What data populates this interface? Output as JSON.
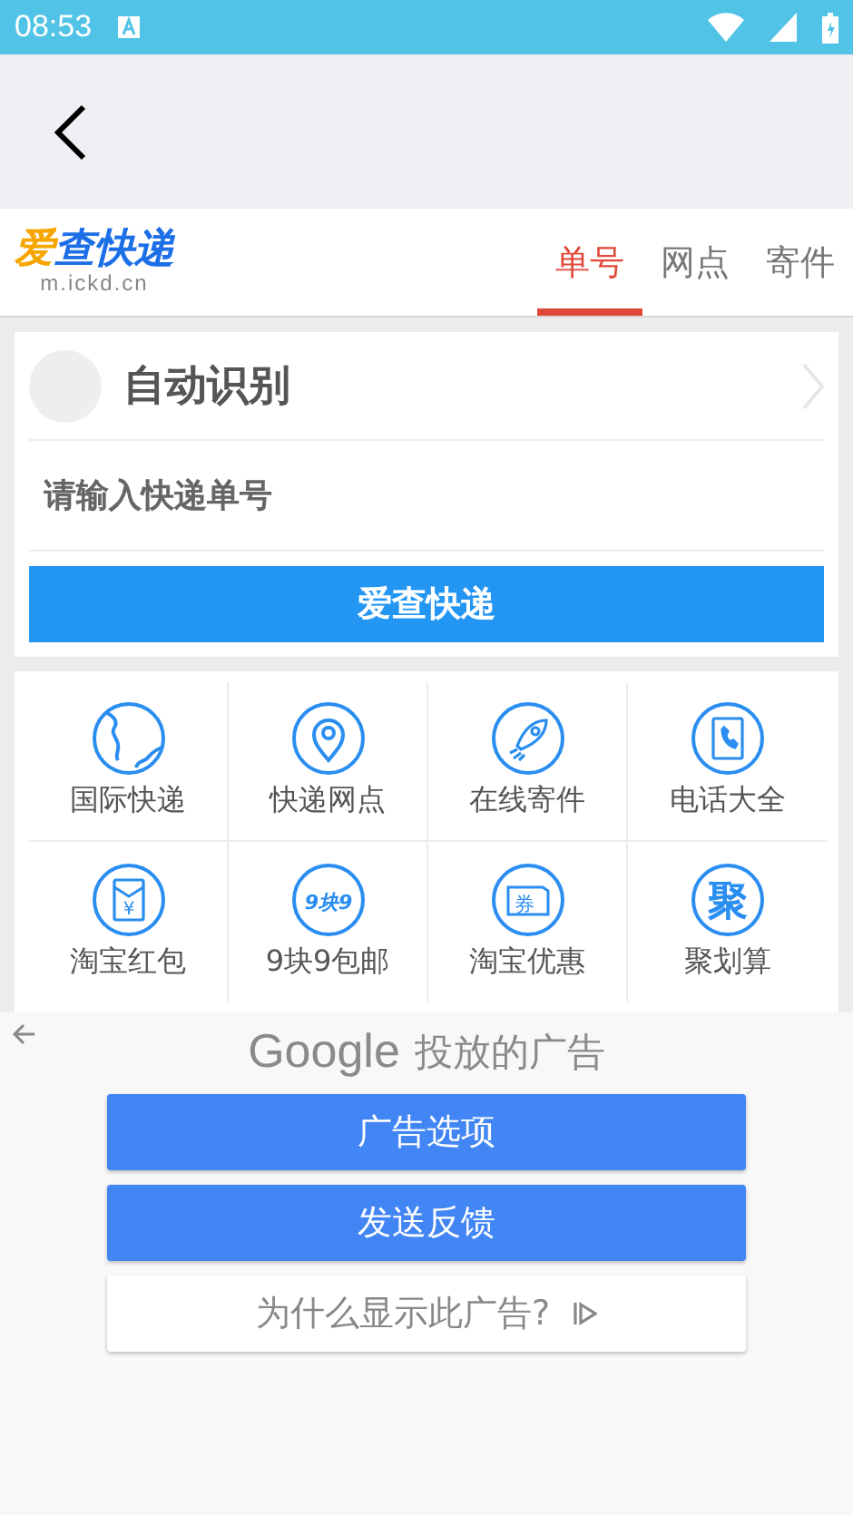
{
  "status_bar": {
    "time": "08:53"
  },
  "logo": {
    "parts": [
      {
        "text": "爱",
        "color": "#f7a600"
      },
      {
        "text": "查快递",
        "color": "#1c6fe6"
      }
    ],
    "domain": "m.ickd.cn"
  },
  "tabs": [
    {
      "label": "单号",
      "selected": true
    },
    {
      "label": "网点",
      "selected": false
    },
    {
      "label": "寄件",
      "selected": false
    }
  ],
  "query": {
    "carrier": "自动识别",
    "placeholder": "请输入快递单号",
    "button": "爱查快递"
  },
  "services": [
    {
      "kind": "globe",
      "label": "国际快递"
    },
    {
      "kind": "pin",
      "label": "快递网点"
    },
    {
      "kind": "rocket",
      "label": "在线寄件"
    },
    {
      "kind": "phonebook",
      "label": "电话大全"
    },
    {
      "kind": "envelope",
      "badge": "¥",
      "label": "淘宝红包"
    },
    {
      "kind": "text",
      "badge": "9块9",
      "label": "9块9包邮"
    },
    {
      "kind": "coupon",
      "badge": "券",
      "label": "淘宝优惠"
    },
    {
      "kind": "bigtext",
      "badge": "聚",
      "label": "聚划算"
    }
  ],
  "ad": {
    "brand": "Google",
    "title": "投放的广告",
    "buttons": [
      {
        "kind": "primary",
        "label": "广告选项"
      },
      {
        "kind": "primary",
        "label": "发送反馈"
      },
      {
        "kind": "secondary",
        "label": "为什么显示此广告?"
      }
    ]
  }
}
